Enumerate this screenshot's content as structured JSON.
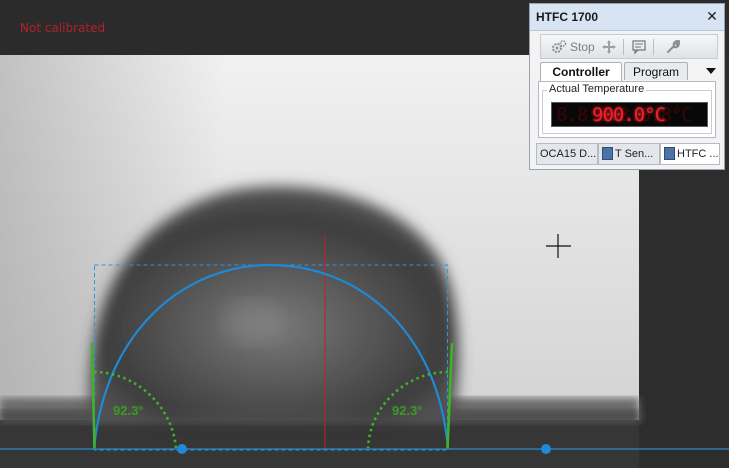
{
  "status": {
    "calibration": "Not calibrated"
  },
  "measurement": {
    "left_angle_label": "92.3°",
    "right_angle_label": "92.3°",
    "contact_angle_left": 92.3,
    "contact_angle_right": 92.3
  },
  "colors": {
    "status_red": "#b3202a",
    "fit_blue": "#1e8ad6",
    "baseline_blue": "#2a8bc9",
    "tangent_green": "#3db22a",
    "angle_text_green": "#3c9b22",
    "led_red": "#f0202a",
    "center_line_red": "#c0202a"
  },
  "window": {
    "title": "HTFC 1700",
    "close_icon": "close-icon",
    "toolbar": {
      "stop_label": "Stop",
      "stop_icon": "gears-icon",
      "move_icon": "move-arrows-icon",
      "comment_icon": "comment-icon",
      "wrench_icon": "wrench-icon"
    },
    "tabs": [
      {
        "label": "Controller",
        "active": true
      },
      {
        "label": "Program",
        "active": false
      }
    ],
    "tabs_dropdown_icon": "chevron-down-icon",
    "group_label": "Actual Temperature",
    "led_display": "900.0°C",
    "led_ghost": "8.8.8.8.8.8°C",
    "bottom_tabs": [
      {
        "label": "OCA15 D...",
        "icon": "",
        "active": false
      },
      {
        "label": "T Sen...",
        "icon": "sensor-icon",
        "active": false
      },
      {
        "label": "HTFC ...",
        "icon": "htfc-icon",
        "active": true
      }
    ]
  }
}
